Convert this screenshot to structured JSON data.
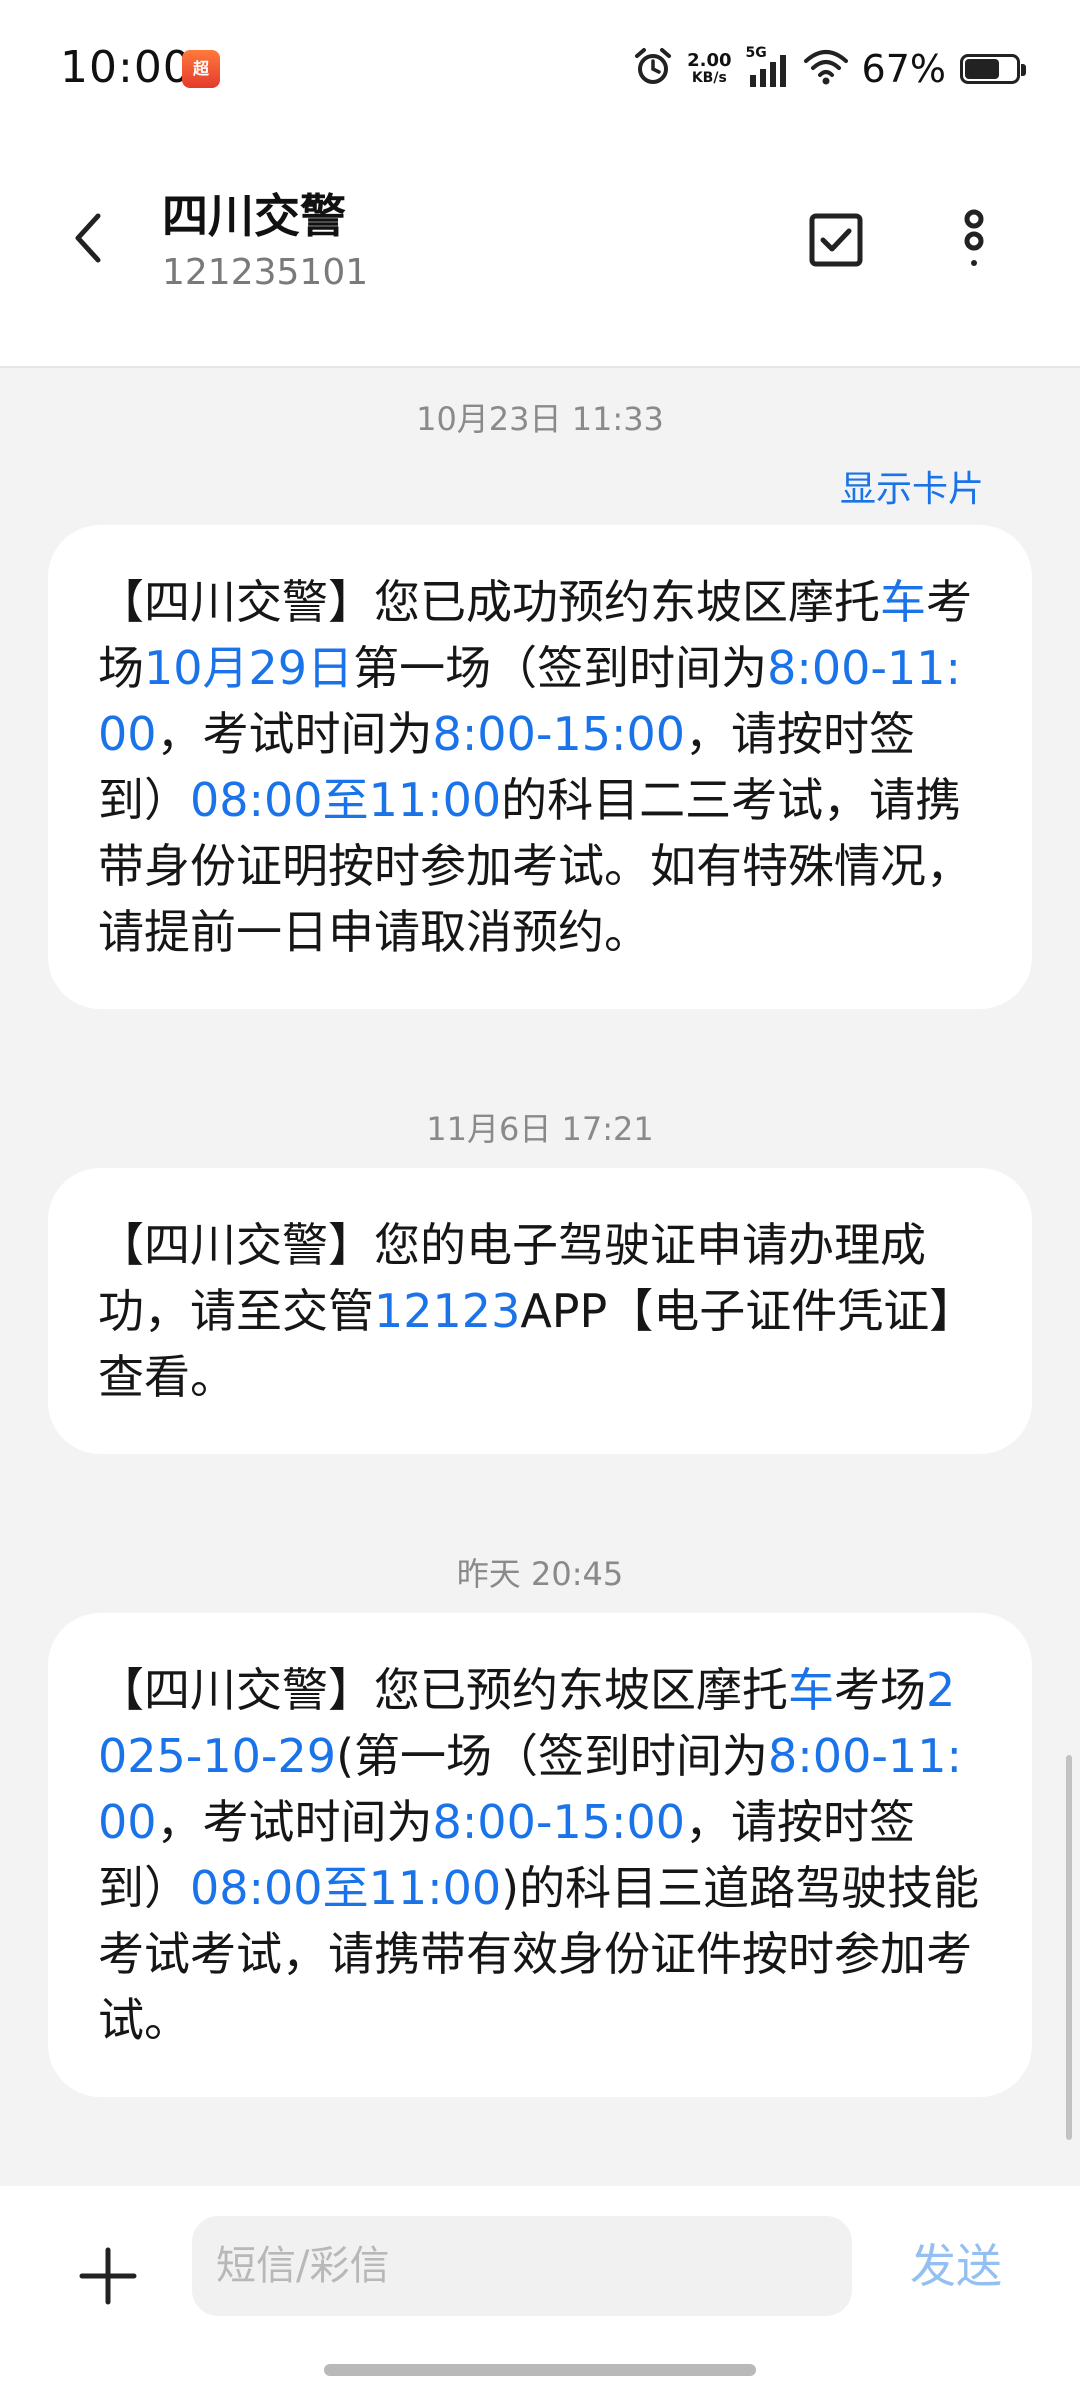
{
  "status_bar": {
    "time": "10:00",
    "app_badge": "超",
    "net_speed_value": "2.00",
    "net_speed_unit": "KB/s",
    "network_type": "5G",
    "battery_percent": "67%",
    "battery_level": 0.67,
    "icons": [
      "alarm-icon",
      "signal-icon",
      "wifi-icon",
      "battery-icon"
    ]
  },
  "header": {
    "contact_name": "四川交警",
    "contact_number": "121235101",
    "icons": [
      "back-arrow-icon",
      "checkbox-icon",
      "more-vertical-icon"
    ]
  },
  "conversation": {
    "show_card_label": "显示卡片",
    "messages": [
      {
        "timestamp": "10月23日 11:33",
        "parts": [
          {
            "text": "【四川交警】您已成功预约东坡区摩托",
            "link": false
          },
          {
            "text": "车",
            "link": true
          },
          {
            "text": "考场",
            "link": false
          },
          {
            "text": "10月29日",
            "link": true
          },
          {
            "text": "第一场（签到时间为",
            "link": false
          },
          {
            "text": "8:00-11:00",
            "link": true
          },
          {
            "text": "，考试时间为",
            "link": false
          },
          {
            "text": "8:00-15:00",
            "link": true
          },
          {
            "text": "，请按时签到）",
            "link": false
          },
          {
            "text": "08:00至11:00",
            "link": true
          },
          {
            "text": "的科目二三考试，请携带身份证明按时参加考试。如有特殊情况，请提前一日申请取消预约。",
            "link": false
          }
        ]
      },
      {
        "timestamp": "11月6日 17:21",
        "parts": [
          {
            "text": "【四川交警】您的电子驾驶证申请办理成功，请至交管",
            "link": false
          },
          {
            "text": "12123",
            "link": true
          },
          {
            "text": "APP【电子证件凭证】查看。",
            "link": false
          }
        ]
      },
      {
        "timestamp": "昨天 20:45",
        "parts": [
          {
            "text": "【四川交警】您已预约东坡区摩托",
            "link": false
          },
          {
            "text": "车",
            "link": true
          },
          {
            "text": "考场",
            "link": false
          },
          {
            "text": "2025-10-29",
            "link": true
          },
          {
            "text": "(第一场（签到时间为",
            "link": false
          },
          {
            "text": "8:00-11:00",
            "link": true
          },
          {
            "text": "，考试时间为",
            "link": false
          },
          {
            "text": "8:00-15:00",
            "link": true
          },
          {
            "text": "，请按时签到）",
            "link": false
          },
          {
            "text": "08:00至11:00",
            "link": true
          },
          {
            "text": ")的科目三道路驾驶技能考试考试，请携带有效身份证件按时参加考试。",
            "link": false
          }
        ]
      }
    ]
  },
  "composer": {
    "placeholder": "短信/彩信",
    "send_label": "发送",
    "icons": [
      "plus-icon"
    ]
  },
  "colors": {
    "link": "#1a73e8",
    "send_disabled": "#93bff2",
    "background": "#f3f3f3",
    "bubble": "#ffffff"
  }
}
